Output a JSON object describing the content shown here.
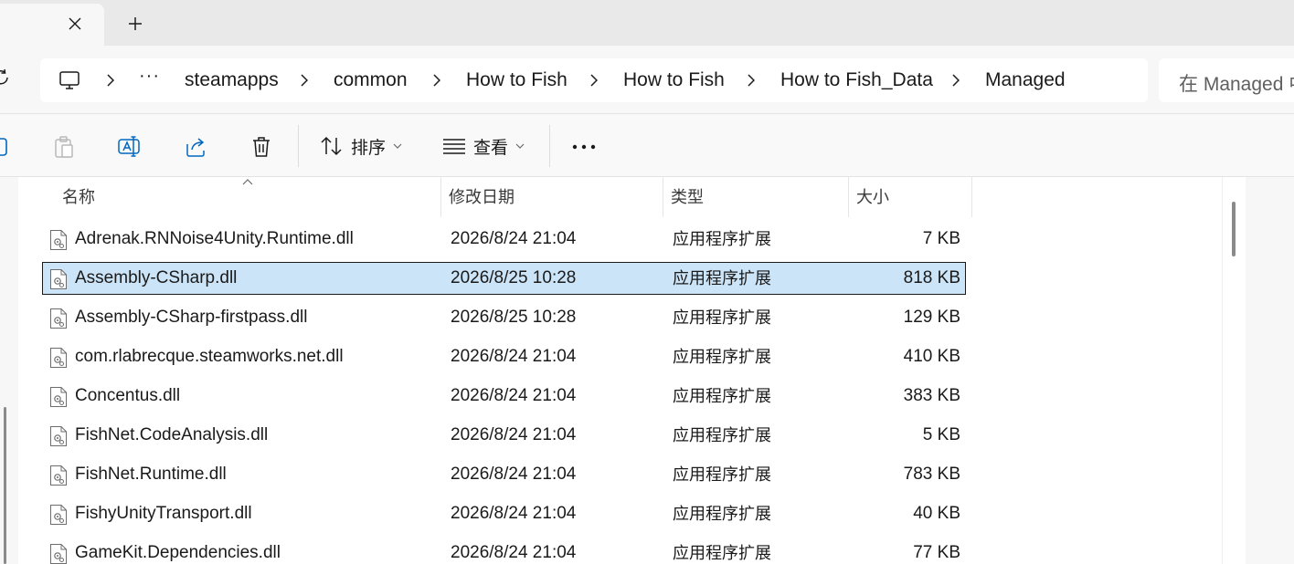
{
  "tab": {
    "close_icon": "close-icon",
    "new_tab_icon": "plus-icon"
  },
  "breadcrumb": {
    "more": "···",
    "items": [
      {
        "label": "steamapps"
      },
      {
        "label": "common"
      },
      {
        "label": "How to Fish"
      },
      {
        "label": "How to Fish"
      },
      {
        "label": "How to Fish_Data"
      },
      {
        "label": "Managed"
      }
    ]
  },
  "search": {
    "placeholder": "在 Managed 中"
  },
  "commands": {
    "sort_label": "排序",
    "view_label": "查看",
    "more_label": "···"
  },
  "columns": {
    "name": "名称",
    "modified": "修改日期",
    "type": "类型",
    "size": "大小"
  },
  "files": [
    {
      "name": "Adrenak.RNNoise4Unity.Runtime.dll",
      "modified": "2026/8/24 21:04",
      "type": "应用程序扩展",
      "size": "7 KB",
      "selected": false
    },
    {
      "name": "Assembly-CSharp.dll",
      "modified": "2026/8/25 10:28",
      "type": "应用程序扩展",
      "size": "818 KB",
      "selected": true
    },
    {
      "name": "Assembly-CSharp-firstpass.dll",
      "modified": "2026/8/25 10:28",
      "type": "应用程序扩展",
      "size": "129 KB",
      "selected": false
    },
    {
      "name": "com.rlabrecque.steamworks.net.dll",
      "modified": "2026/8/24 21:04",
      "type": "应用程序扩展",
      "size": "410 KB",
      "selected": false
    },
    {
      "name": "Concentus.dll",
      "modified": "2026/8/24 21:04",
      "type": "应用程序扩展",
      "size": "383 KB",
      "selected": false
    },
    {
      "name": "FishNet.CodeAnalysis.dll",
      "modified": "2026/8/24 21:04",
      "type": "应用程序扩展",
      "size": "5 KB",
      "selected": false
    },
    {
      "name": "FishNet.Runtime.dll",
      "modified": "2026/8/24 21:04",
      "type": "应用程序扩展",
      "size": "783 KB",
      "selected": false
    },
    {
      "name": "FishyUnityTransport.dll",
      "modified": "2026/8/24 21:04",
      "type": "应用程序扩展",
      "size": "40 KB",
      "selected": false
    },
    {
      "name": "GameKit.Dependencies.dll",
      "modified": "2026/8/24 21:04",
      "type": "应用程序扩展",
      "size": "77 KB",
      "selected": false
    }
  ],
  "colors": {
    "selection": "#cce4f7",
    "accent": "#0067c0"
  }
}
